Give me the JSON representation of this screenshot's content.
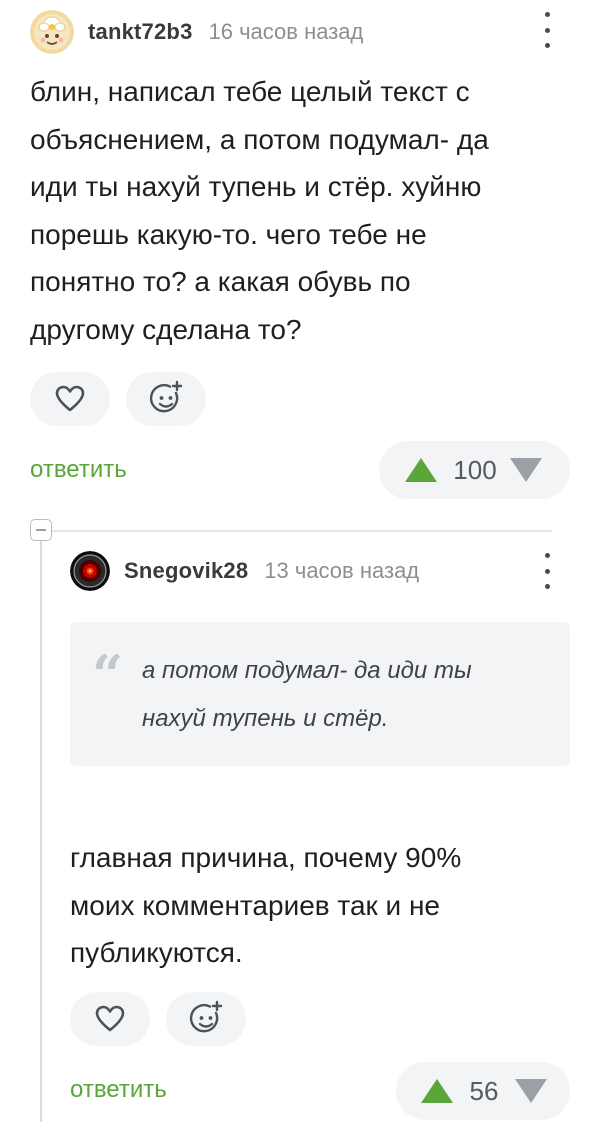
{
  "comments": [
    {
      "username": "tankt72b3",
      "timestamp": "16 часов назад",
      "avatar_icon": "avatar-flower-icon",
      "text_lines": [
        "блин, написал тебе целый текст с",
        "объяснением, а потом подумал- да",
        "иди ты нахуй тупень и стёр. хуйню",
        "порешь какую-то. чего тебе не",
        "понятно то? а какая обувь по",
        "другому сделана то?"
      ],
      "reply_label": "ответить",
      "rating": "100"
    },
    {
      "username": "Snegovik28",
      "timestamp": "13 часов назад",
      "avatar_icon": "avatar-hal-eye-icon",
      "quote_lines": [
        "а потом подумал- да иди ты",
        "нахуй тупень и стёр."
      ],
      "text_lines": [
        "главная причина, почему 90%",
        "моих комментариев так и не",
        "публикуются."
      ],
      "reply_label": "ответить",
      "rating": "56"
    }
  ],
  "colors": {
    "accent_green": "#5aa63a",
    "vote_down_gray": "#9aa0a6",
    "pill_background": "#f3f4f6"
  },
  "icons": {
    "like": "heart-icon",
    "react": "smiley-plus-icon",
    "menu": "vertical-dots-icon",
    "vote_up": "triangle-up-icon",
    "vote_down": "triangle-down-icon",
    "collapse": "minus-square-icon"
  }
}
